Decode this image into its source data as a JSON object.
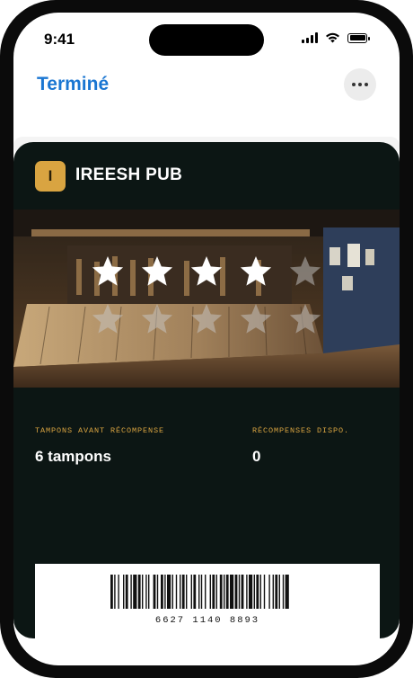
{
  "status_bar": {
    "time": "9:41"
  },
  "nav": {
    "done_label": "Terminé",
    "more_icon": "ellipsis-icon"
  },
  "card": {
    "logo_letter": "I",
    "venue_name": "IREESH PUB",
    "stamps": {
      "total": 10,
      "filled": 4
    },
    "fields": [
      {
        "label": "TAMPONS AVANT RÉCOMPENSE",
        "value": "6 tampons"
      },
      {
        "label": "RÉCOMPENSES DISPO.",
        "value": "0"
      }
    ],
    "barcode_number": "6627 1140 8893"
  },
  "colors": {
    "accent": "#1a76d2",
    "card_background": "#0c1614",
    "label_gold": "#d9a441",
    "logo_gold": "#d9a441"
  }
}
